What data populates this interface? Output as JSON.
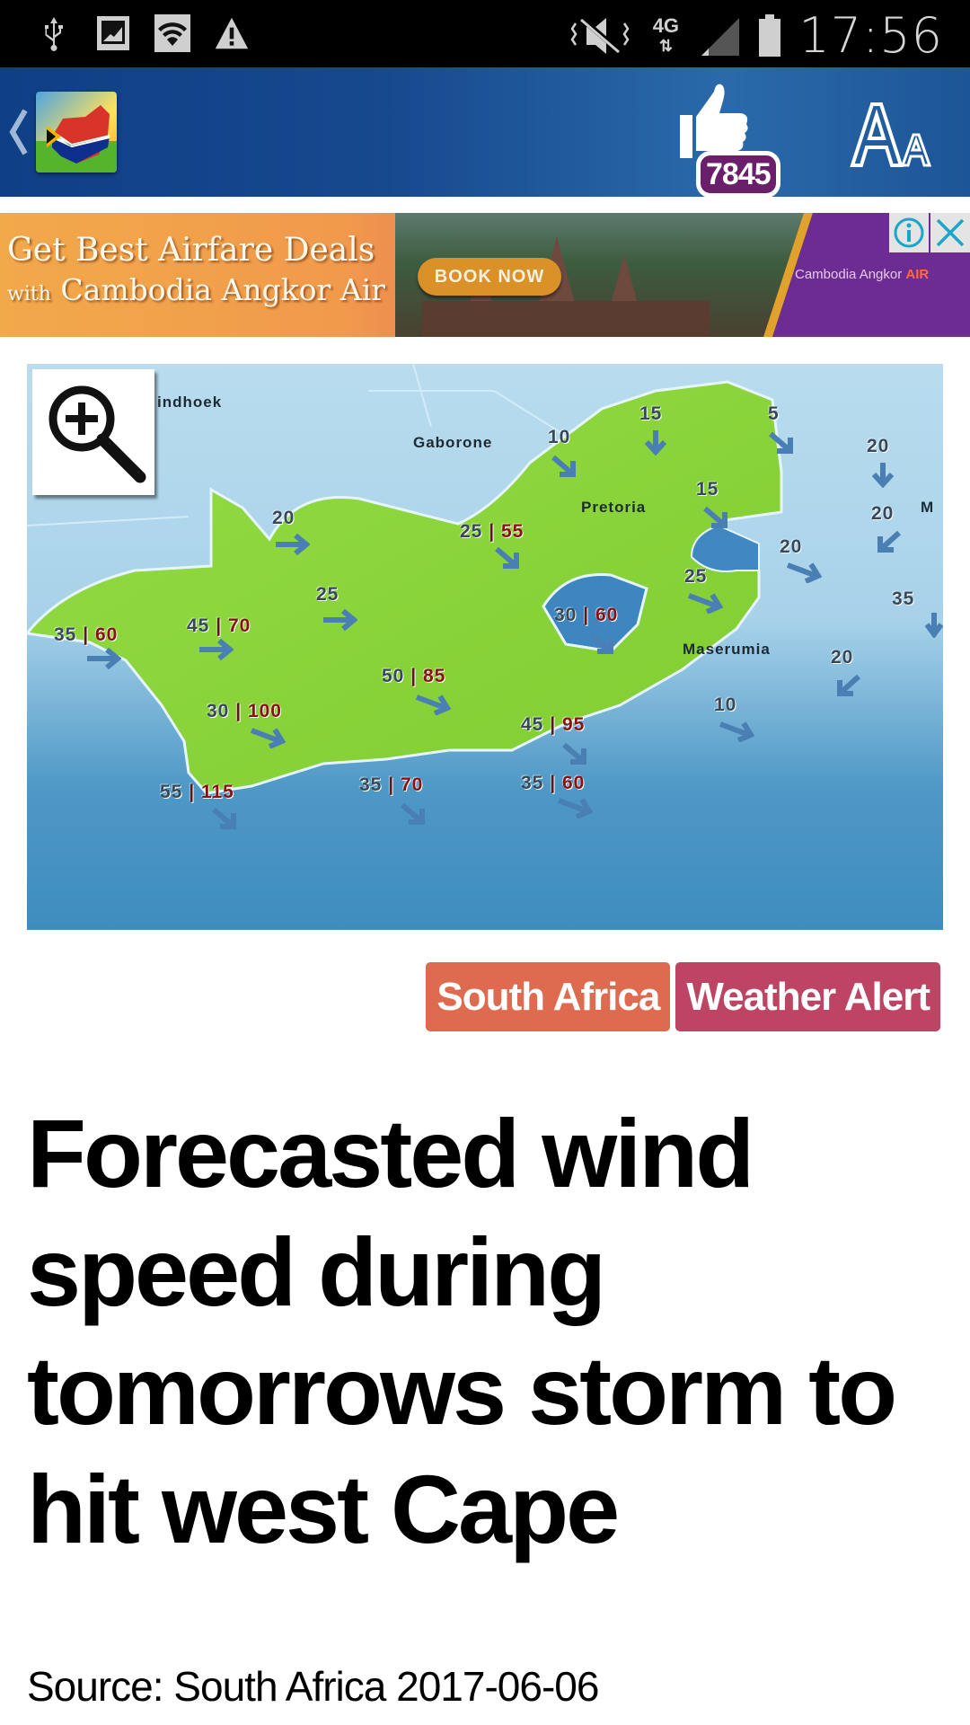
{
  "status_bar": {
    "time": "17:56",
    "network": "4G",
    "left_icons": [
      "usb-icon",
      "screenshot-icon",
      "wifi-icon",
      "warning-icon"
    ],
    "right_icons": [
      "vibrate-mute-icon",
      "4g-data-icon",
      "signal-icon",
      "battery-icon"
    ]
  },
  "header": {
    "back_icon": "chevron-left-icon",
    "logo": "south-africa-app-logo",
    "like_count": "7845",
    "font_size_label": "Aa"
  },
  "ad": {
    "headline_line1": "Get Best Airfare Deals",
    "headline_with": "with",
    "headline_line2": "Cambodia Angkor Air",
    "cta": "BOOK NOW",
    "brand_name": "Cambodia Angkor",
    "brand_suffix": "AIR",
    "info_icon": "info-icon",
    "close_icon": "close-icon"
  },
  "map": {
    "zoom_icon": "zoom-in-icon",
    "cities": [
      {
        "name": "Windhoek",
        "display": "indhoek"
      },
      {
        "name": "Gaborone",
        "display": "Gaborone"
      },
      {
        "name": "Pretoria",
        "display": "Pretoria"
      },
      {
        "name": "Maserumia",
        "display": "Maserumia"
      },
      {
        "name": "Maputo",
        "display": "M"
      }
    ],
    "wind_labels": [
      {
        "speed": "15",
        "gust": null
      },
      {
        "speed": "5",
        "gust": null
      },
      {
        "speed": "20",
        "gust": null
      },
      {
        "speed": "10",
        "gust": null
      },
      {
        "speed": "15",
        "gust": null
      },
      {
        "speed": "20",
        "gust": null
      },
      {
        "speed": "20",
        "gust": null
      },
      {
        "speed": "20",
        "gust": null
      },
      {
        "speed": "25",
        "gust": "55"
      },
      {
        "speed": "25",
        "gust": null
      },
      {
        "speed": "35",
        "gust": null
      },
      {
        "speed": "25",
        "gust": null
      },
      {
        "speed": "30",
        "gust": "60"
      },
      {
        "speed": "35",
        "gust": "60"
      },
      {
        "speed": "45",
        "gust": "70"
      },
      {
        "speed": "20",
        "gust": null
      },
      {
        "speed": "50",
        "gust": "85"
      },
      {
        "speed": "10",
        "gust": null
      },
      {
        "speed": "30",
        "gust": "100"
      },
      {
        "speed": "45",
        "gust": "95"
      },
      {
        "speed": "55",
        "gust": "115"
      },
      {
        "speed": "35",
        "gust": "70"
      },
      {
        "speed": "35",
        "gust": "60"
      }
    ],
    "separator": "|"
  },
  "tags": [
    "South Africa",
    "Weather Alert"
  ],
  "article": {
    "title": "Forecasted wind speed during tomorrows storm to hit west Cape",
    "source": "Source: South Africa 2017-06-06"
  },
  "colors": {
    "header_blue": "#17498f",
    "like_badge": "#6b1f6b",
    "tag_south_africa": "#de6a4f",
    "tag_weather_alert": "#bd4563",
    "gust_red": "#8b1111",
    "land_green": "#8fd63c"
  }
}
